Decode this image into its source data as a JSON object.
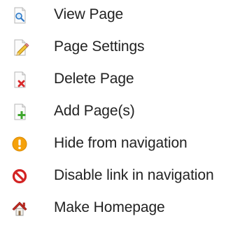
{
  "menu": {
    "items": [
      {
        "label": "View Page",
        "icon": "view-page-icon"
      },
      {
        "label": "Page Settings",
        "icon": "page-settings-icon"
      },
      {
        "label": "Delete Page",
        "icon": "delete-page-icon"
      },
      {
        "label": "Add Page(s)",
        "icon": "add-page-icon"
      },
      {
        "label": "Hide from navigation",
        "icon": "hide-warning-icon"
      },
      {
        "label": "Disable link in navigation",
        "icon": "disable-link-icon"
      },
      {
        "label": "Make Homepage",
        "icon": "home-icon"
      }
    ]
  },
  "colors": {
    "text": "#222222",
    "delete_red": "#d9292b",
    "add_green": "#3ea62d",
    "warning_orange": "#f5a10b",
    "disable_red": "#d32323",
    "home_red": "#c62b22",
    "pencil_yellow": "#f2c63a",
    "magnifier_blue": "#2b77c7"
  }
}
